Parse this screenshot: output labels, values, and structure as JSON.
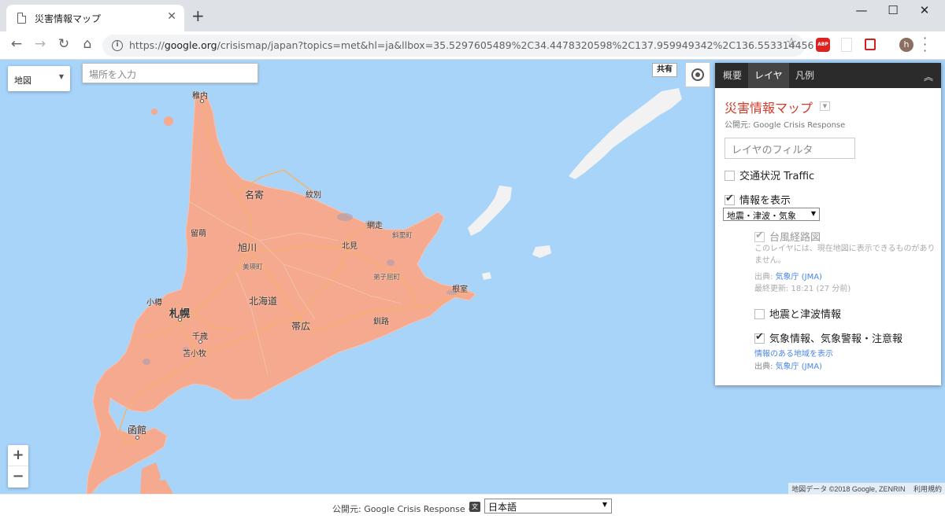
{
  "browser": {
    "tab_title": "災害情報マップ",
    "tab_close": "✕",
    "new_tab": "+",
    "url_prefix": "https://",
    "url_host": "google.org",
    "url_rest": "/crisismap/japan?topics=met&hl=ja&llbox=35.5297605489%2C34.4478320598%2C137.959949342%2C136.553314456",
    "profile_initial": "h",
    "ext_abp": "ABP",
    "window_controls": {
      "minimize": "—",
      "maximize": "☐",
      "close": "✕"
    },
    "nav": {
      "back": "←",
      "forward": "→",
      "reload": "↻",
      "home": "⌂"
    },
    "star": "☆",
    "info": "i"
  },
  "map": {
    "map_type": "地図",
    "search_placeholder": "場所を入力",
    "share": "共有",
    "zoom_in": "+",
    "zoom_out": "−",
    "attribution": "地図データ ©2018 Google, ZENRIN",
    "terms": "利用規約",
    "labels": {
      "wakkanai": "稚内",
      "nayoro": "名寄",
      "monbetsu": "紋別",
      "rumoi": "留萌",
      "asahikawa": "旭川",
      "abashiri": "網走",
      "shari": "斜里町",
      "kitami": "北見",
      "bihoro": "美瑛町",
      "teshikaga": "弟子屈町",
      "hokkaido": "北海道",
      "otaru": "小樽",
      "sapporo": "札幌",
      "nemuro": "根室",
      "obihiro": "帯広",
      "kushiro": "釧路",
      "chitose": "千歳",
      "tomakomai": "苫小牧",
      "hakodate": "函館"
    }
  },
  "panel": {
    "tabs": [
      "概要",
      "レイヤ",
      "凡例"
    ],
    "collapse": "︽",
    "title": "災害情報マップ",
    "publisher": "公開元: Google Crisis Response",
    "filter_placeholder": "レイヤのフィルタ",
    "layer_traffic": "交通状況 Traffic",
    "layer_info": "情報を表示",
    "info_select": "地震・津波・気象",
    "sub_typhoon": "台風経路図",
    "typhoon_note": "このレイヤには、現在地図に表示できるものがありません。",
    "source_label": "出典: ",
    "source_jma": "気象庁 (JMA)",
    "updated": "最終更新: 18:21 (27 分前)",
    "sub_quake": "地震と津波情報",
    "sub_weather": "気象情報、気象警報・注意報",
    "weather_link": "情報のある地域を表示",
    "source_label2": "出典: ",
    "source_jma2": "気象庁 (JMA)"
  },
  "footer": {
    "publisher": "公開元: Google Crisis Response ·",
    "lang_icon": "文",
    "language": "日本語"
  },
  "colors": {
    "sea": "#a8d4fa",
    "land_hokkaido": "#f5a98e",
    "land_other": "#f2f2f2",
    "title_red": "#d23b2a",
    "link": "#4a86e8"
  }
}
